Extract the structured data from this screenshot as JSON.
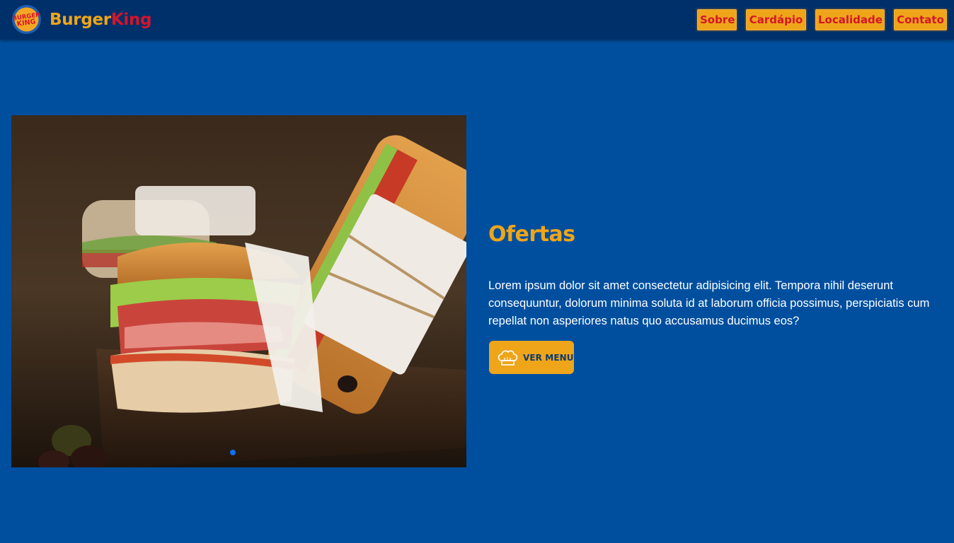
{
  "header": {
    "logo_text": "BURGER KING",
    "brand_part1": "Burger",
    "brand_part2": "King",
    "nav": [
      {
        "label": "Sobre"
      },
      {
        "label": "Cardápio"
      },
      {
        "label": "Localidade"
      },
      {
        "label": "Contato"
      }
    ]
  },
  "hero": {
    "carousel_slide_count": 1,
    "carousel_active_index": 0
  },
  "offer": {
    "title": "Ofertas",
    "text": "Lorem ipsum dolor sit amet consectetur adipisicing elit. Tempora nihil deserunt consequuntur, dolorum minima soluta id at laborum officia possimus, perspiciatis cum repellat non asperiores natus quo accusamus ducimus eos?",
    "button_label": "VER MENU",
    "button_icon": "chef-hat-icon"
  },
  "colors": {
    "background": "#004f9f",
    "header": "#00306a",
    "accent_yellow": "#efa51a",
    "accent_red": "#d4152b",
    "carousel_dot": "#0d6efd"
  }
}
